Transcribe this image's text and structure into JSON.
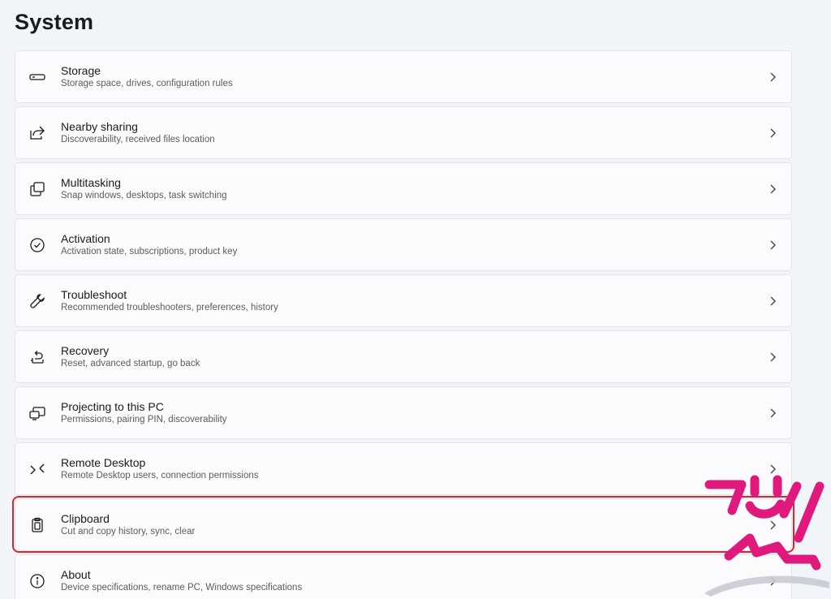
{
  "page": {
    "title": "System"
  },
  "items": [
    {
      "title": "Storage",
      "desc": "Storage space, drives, configuration rules",
      "icon": "storage-icon"
    },
    {
      "title": "Nearby sharing",
      "desc": "Discoverability, received files location",
      "icon": "share-icon"
    },
    {
      "title": "Multitasking",
      "desc": "Snap windows, desktops, task switching",
      "icon": "multitasking-icon"
    },
    {
      "title": "Activation",
      "desc": "Activation state, subscriptions, product key",
      "icon": "check-circle-icon"
    },
    {
      "title": "Troubleshoot",
      "desc": "Recommended troubleshooters, preferences, history",
      "icon": "wrench-icon"
    },
    {
      "title": "Recovery",
      "desc": "Reset, advanced startup, go back",
      "icon": "recovery-icon"
    },
    {
      "title": "Projecting to this PC",
      "desc": "Permissions, pairing PIN, discoverability",
      "icon": "projecting-icon"
    },
    {
      "title": "Remote Desktop",
      "desc": "Remote Desktop users, connection permissions",
      "icon": "remote-desktop-icon"
    },
    {
      "title": "Clipboard",
      "desc": "Cut and copy history, sync, clear",
      "icon": "clipboard-icon"
    },
    {
      "title": "About",
      "desc": "Device specifications, rename PC, Windows specifications",
      "icon": "info-icon"
    }
  ],
  "colors": {
    "highlight": "#e0242e",
    "watermark": "#e0197d"
  }
}
